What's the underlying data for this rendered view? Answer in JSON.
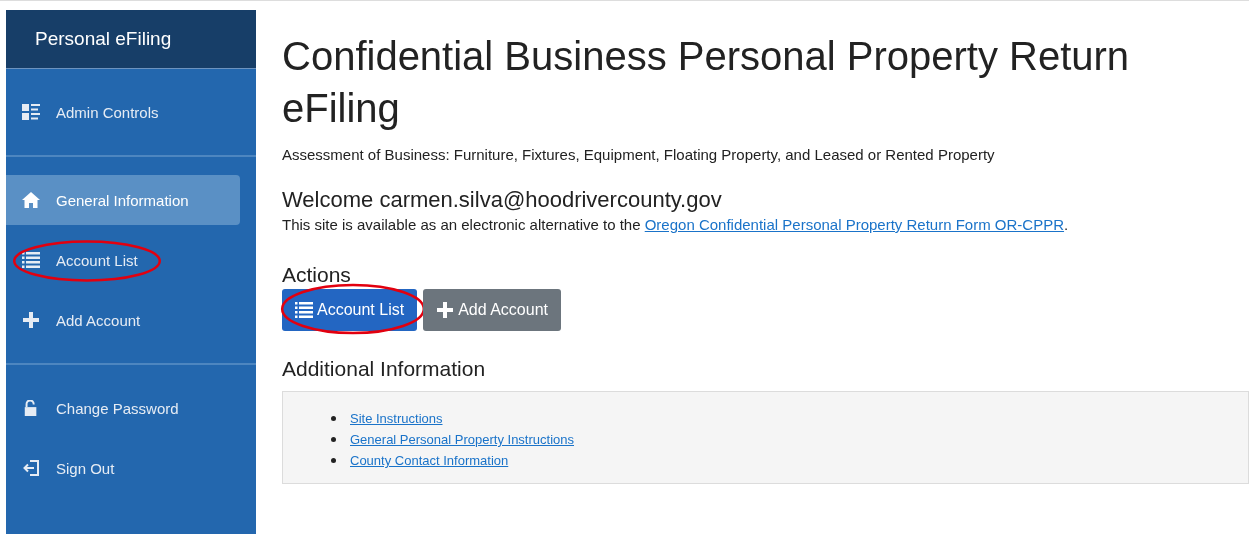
{
  "sidebar": {
    "title": "Personal eFiling",
    "groups": [
      [
        {
          "label": "Admin Controls",
          "kind": "admin",
          "selected": false,
          "circled": false
        }
      ],
      [
        {
          "label": "General Information",
          "kind": "home",
          "selected": true,
          "circled": false
        },
        {
          "label": "Account List",
          "kind": "list",
          "selected": false,
          "circled": true
        },
        {
          "label": "Add Account",
          "kind": "plus",
          "selected": false,
          "circled": false
        }
      ],
      [
        {
          "label": "Change Password",
          "kind": "lock",
          "selected": false,
          "circled": false
        },
        {
          "label": "Sign Out",
          "kind": "signout",
          "selected": false,
          "circled": false
        }
      ]
    ]
  },
  "main": {
    "title": "Confidential Business Personal Property Return eFiling",
    "subtitle": "Assessment of Business: Furniture, Fixtures, Equipment, Floating Property, and Leased or Rented Property",
    "welcome": "Welcome carmen.silva@hoodrivercounty.gov",
    "intro": "This site is available as an electronic alternative to the ",
    "intro_link": "Oregon Confidential Personal Property Return Form OR-CPPR",
    "intro_end": ".",
    "actions_heading": "Actions",
    "actions": [
      {
        "label": "Account List",
        "kind": "list",
        "circled": true
      },
      {
        "label": "Add Account",
        "kind": "plus",
        "circled": false
      }
    ],
    "additional_heading": "Additional Information",
    "links": [
      "Site Instructions",
      "General Personal Property Instructions",
      "County Contact Information"
    ]
  }
}
